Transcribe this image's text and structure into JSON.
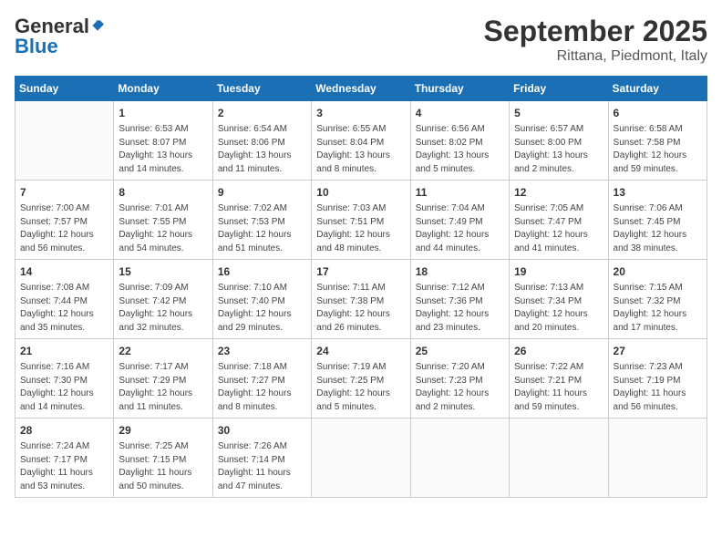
{
  "header": {
    "logo_general": "General",
    "logo_blue": "Blue",
    "month_title": "September 2025",
    "subtitle": "Rittana, Piedmont, Italy"
  },
  "days_of_week": [
    "Sunday",
    "Monday",
    "Tuesday",
    "Wednesday",
    "Thursday",
    "Friday",
    "Saturday"
  ],
  "weeks": [
    [
      {
        "day": "",
        "info": ""
      },
      {
        "day": "1",
        "info": "Sunrise: 6:53 AM\nSunset: 8:07 PM\nDaylight: 13 hours\nand 14 minutes."
      },
      {
        "day": "2",
        "info": "Sunrise: 6:54 AM\nSunset: 8:06 PM\nDaylight: 13 hours\nand 11 minutes."
      },
      {
        "day": "3",
        "info": "Sunrise: 6:55 AM\nSunset: 8:04 PM\nDaylight: 13 hours\nand 8 minutes."
      },
      {
        "day": "4",
        "info": "Sunrise: 6:56 AM\nSunset: 8:02 PM\nDaylight: 13 hours\nand 5 minutes."
      },
      {
        "day": "5",
        "info": "Sunrise: 6:57 AM\nSunset: 8:00 PM\nDaylight: 13 hours\nand 2 minutes."
      },
      {
        "day": "6",
        "info": "Sunrise: 6:58 AM\nSunset: 7:58 PM\nDaylight: 12 hours\nand 59 minutes."
      }
    ],
    [
      {
        "day": "7",
        "info": "Sunrise: 7:00 AM\nSunset: 7:57 PM\nDaylight: 12 hours\nand 56 minutes."
      },
      {
        "day": "8",
        "info": "Sunrise: 7:01 AM\nSunset: 7:55 PM\nDaylight: 12 hours\nand 54 minutes."
      },
      {
        "day": "9",
        "info": "Sunrise: 7:02 AM\nSunset: 7:53 PM\nDaylight: 12 hours\nand 51 minutes."
      },
      {
        "day": "10",
        "info": "Sunrise: 7:03 AM\nSunset: 7:51 PM\nDaylight: 12 hours\nand 48 minutes."
      },
      {
        "day": "11",
        "info": "Sunrise: 7:04 AM\nSunset: 7:49 PM\nDaylight: 12 hours\nand 44 minutes."
      },
      {
        "day": "12",
        "info": "Sunrise: 7:05 AM\nSunset: 7:47 PM\nDaylight: 12 hours\nand 41 minutes."
      },
      {
        "day": "13",
        "info": "Sunrise: 7:06 AM\nSunset: 7:45 PM\nDaylight: 12 hours\nand 38 minutes."
      }
    ],
    [
      {
        "day": "14",
        "info": "Sunrise: 7:08 AM\nSunset: 7:44 PM\nDaylight: 12 hours\nand 35 minutes."
      },
      {
        "day": "15",
        "info": "Sunrise: 7:09 AM\nSunset: 7:42 PM\nDaylight: 12 hours\nand 32 minutes."
      },
      {
        "day": "16",
        "info": "Sunrise: 7:10 AM\nSunset: 7:40 PM\nDaylight: 12 hours\nand 29 minutes."
      },
      {
        "day": "17",
        "info": "Sunrise: 7:11 AM\nSunset: 7:38 PM\nDaylight: 12 hours\nand 26 minutes."
      },
      {
        "day": "18",
        "info": "Sunrise: 7:12 AM\nSunset: 7:36 PM\nDaylight: 12 hours\nand 23 minutes."
      },
      {
        "day": "19",
        "info": "Sunrise: 7:13 AM\nSunset: 7:34 PM\nDaylight: 12 hours\nand 20 minutes."
      },
      {
        "day": "20",
        "info": "Sunrise: 7:15 AM\nSunset: 7:32 PM\nDaylight: 12 hours\nand 17 minutes."
      }
    ],
    [
      {
        "day": "21",
        "info": "Sunrise: 7:16 AM\nSunset: 7:30 PM\nDaylight: 12 hours\nand 14 minutes."
      },
      {
        "day": "22",
        "info": "Sunrise: 7:17 AM\nSunset: 7:29 PM\nDaylight: 12 hours\nand 11 minutes."
      },
      {
        "day": "23",
        "info": "Sunrise: 7:18 AM\nSunset: 7:27 PM\nDaylight: 12 hours\nand 8 minutes."
      },
      {
        "day": "24",
        "info": "Sunrise: 7:19 AM\nSunset: 7:25 PM\nDaylight: 12 hours\nand 5 minutes."
      },
      {
        "day": "25",
        "info": "Sunrise: 7:20 AM\nSunset: 7:23 PM\nDaylight: 12 hours\nand 2 minutes."
      },
      {
        "day": "26",
        "info": "Sunrise: 7:22 AM\nSunset: 7:21 PM\nDaylight: 11 hours\nand 59 minutes."
      },
      {
        "day": "27",
        "info": "Sunrise: 7:23 AM\nSunset: 7:19 PM\nDaylight: 11 hours\nand 56 minutes."
      }
    ],
    [
      {
        "day": "28",
        "info": "Sunrise: 7:24 AM\nSunset: 7:17 PM\nDaylight: 11 hours\nand 53 minutes."
      },
      {
        "day": "29",
        "info": "Sunrise: 7:25 AM\nSunset: 7:15 PM\nDaylight: 11 hours\nand 50 minutes."
      },
      {
        "day": "30",
        "info": "Sunrise: 7:26 AM\nSunset: 7:14 PM\nDaylight: 11 hours\nand 47 minutes."
      },
      {
        "day": "",
        "info": ""
      },
      {
        "day": "",
        "info": ""
      },
      {
        "day": "",
        "info": ""
      },
      {
        "day": "",
        "info": ""
      }
    ]
  ]
}
